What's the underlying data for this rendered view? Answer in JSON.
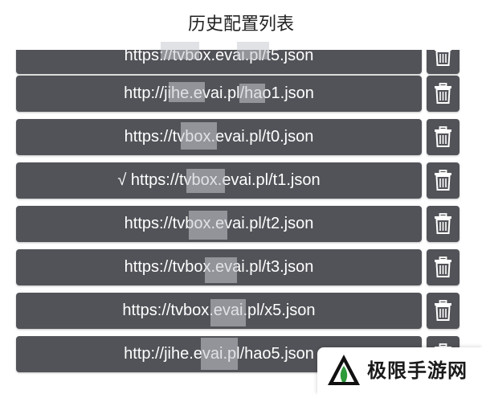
{
  "dialog": {
    "title": "历史配置列表"
  },
  "items": [
    {
      "url": "https://tvbox.evai.pl/t5.json"
    },
    {
      "url": "http://jihe.evai.pl/hao1.json"
    },
    {
      "url": "https://tvbox.evai.pl/t0.json"
    },
    {
      "url": "√ https://tvbox.evai.pl/t1.json"
    },
    {
      "url": "https://tvbox.evai.pl/t2.json"
    },
    {
      "url": "https://tvbox.evai.pl/t3.json"
    },
    {
      "url": "https://tvbox.evai.pl/x5.json"
    },
    {
      "url": "http://jihe.evai.pl/hao5.json"
    }
  ],
  "icons": {
    "delete": "trash-icon",
    "watermark": "jixian-logo-icon"
  },
  "watermark": {
    "text": "极限手游网"
  },
  "colors": {
    "item_bg": "#525358",
    "item_text": "#ffffff",
    "logo_green": "#2e9b3a",
    "logo_dark": "#111111"
  }
}
